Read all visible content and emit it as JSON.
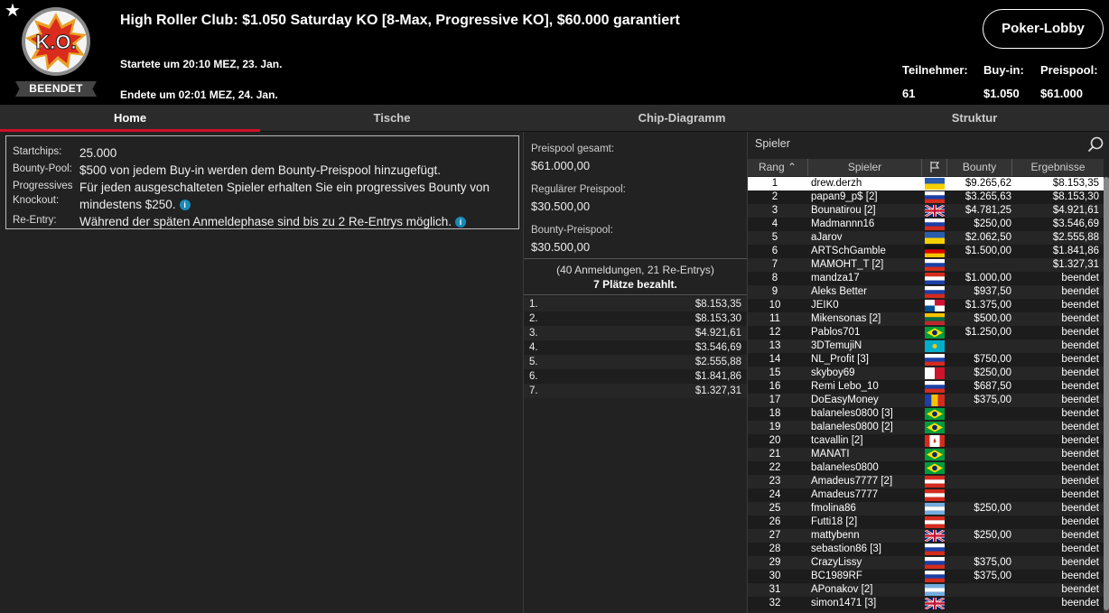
{
  "header": {
    "title": "High Roller Club: $1.050 Saturday KO [8-Max, Progressive KO], $60.000 garantiert",
    "logo_text": "K.O.",
    "status_badge": "BEENDET",
    "started": "Startete um 20:10 MEZ, 23. Jan.",
    "ended": "Endete um 02:01 MEZ, 24. Jan.",
    "lobby_button": "Poker-Lobby",
    "stats": {
      "participants_label": "Teilnehmer:",
      "participants_value": "61",
      "buyin_label": "Buy-in:",
      "buyin_value": "$1.050",
      "prizepool_label": "Preispool:",
      "prizepool_value": "$61.000"
    }
  },
  "tabs": [
    {
      "label": "Home",
      "active": true
    },
    {
      "label": "Tische",
      "active": false
    },
    {
      "label": "Chip-Diagramm",
      "active": false
    },
    {
      "label": "Struktur",
      "active": false
    }
  ],
  "info": {
    "startchips_label": "Startchips:",
    "startchips_value": "25.000",
    "bountypool_label": "Bounty-Pool:",
    "bountypool_value": "$500 von jedem Buy-in werden dem Bounty-Preispool hinzugefügt.",
    "pko_label": "Progressives Knockout:",
    "pko_value": "Für jeden ausgeschalteten Spieler erhalten Sie ein progressives Bounty von mindestens $250.",
    "reentry_label": "Re-Entry:",
    "reentry_value": "Während der späten Anmeldephase sind bis zu 2 Re-Entrys möglich."
  },
  "prize": {
    "total_label": "Preispool gesamt:",
    "total_value": "$61.000,00",
    "regular_label": "Regulärer Preispool:",
    "regular_value": "$30.500,00",
    "bounty_label": "Bounty-Preispool:",
    "bounty_value": "$30.500,00",
    "registrations": "(40 Anmeldungen, 21 Re-Entrys)",
    "paid_places": "7 Plätze bezahlt.",
    "payouts": [
      {
        "place": "1.",
        "amount": "$8.153,35"
      },
      {
        "place": "2.",
        "amount": "$8.153,30"
      },
      {
        "place": "3.",
        "amount": "$4.921,61"
      },
      {
        "place": "4.",
        "amount": "$3.546,69"
      },
      {
        "place": "5.",
        "amount": "$2.555,88"
      },
      {
        "place": "6.",
        "amount": "$1.841,86"
      },
      {
        "place": "7.",
        "amount": "$1.327,31"
      }
    ]
  },
  "players": {
    "search_placeholder": "Spieler",
    "columns": {
      "rank": "Rang",
      "player": "Spieler",
      "bounty": "Bounty",
      "result": "Ergebnisse"
    },
    "rows": [
      {
        "rank": "1",
        "name": "drew.derzh",
        "flag": "ukraine",
        "bounty": "$9.265,62",
        "result": "$8.153,35"
      },
      {
        "rank": "2",
        "name": "papan9_p$ [2]",
        "flag": "russia",
        "bounty": "$3.265,63",
        "result": "$8.153,30"
      },
      {
        "rank": "3",
        "name": "Bounatirou [2]",
        "flag": "uk",
        "bounty": "$4.781,25",
        "result": "$4.921,61"
      },
      {
        "rank": "4",
        "name": "Madmannn16",
        "flag": "russia",
        "bounty": "$250,00",
        "result": "$3.546,69"
      },
      {
        "rank": "5",
        "name": "aJarov",
        "flag": "ukraine",
        "bounty": "$2.062,50",
        "result": "$2.555,88"
      },
      {
        "rank": "6",
        "name": "ARTSchGamble",
        "flag": "germany",
        "bounty": "$1.500,00",
        "result": "$1.841,86"
      },
      {
        "rank": "7",
        "name": "MAMOHT_T [2]",
        "flag": "russia",
        "bounty": "",
        "result": "$1.327,31"
      },
      {
        "rank": "8",
        "name": "mandza17",
        "flag": "croatia",
        "bounty": "$1.000,00",
        "result": "beendet"
      },
      {
        "rank": "9",
        "name": "Aleks Better",
        "flag": "russia",
        "bounty": "$937,50",
        "result": "beendet"
      },
      {
        "rank": "10",
        "name": "JEIK0",
        "flag": "panama",
        "bounty": "$1.375,00",
        "result": "beendet"
      },
      {
        "rank": "11",
        "name": "Mikensonas [2]",
        "flag": "lithuania",
        "bounty": "$500,00",
        "result": "beendet"
      },
      {
        "rank": "12",
        "name": "Pablos701",
        "flag": "brazil",
        "bounty": "$1.250,00",
        "result": "beendet"
      },
      {
        "rank": "13",
        "name": "3DTemujiN",
        "flag": "kazakhstan",
        "bounty": "",
        "result": "beendet"
      },
      {
        "rank": "14",
        "name": "NL_Profit [3]",
        "flag": "russia",
        "bounty": "$750,00",
        "result": "beendet"
      },
      {
        "rank": "15",
        "name": "skyboy69",
        "flag": "malta",
        "bounty": "$250,00",
        "result": "beendet"
      },
      {
        "rank": "16",
        "name": "Remi Lebo_10",
        "flag": "russia",
        "bounty": "$687,50",
        "result": "beendet"
      },
      {
        "rank": "17",
        "name": "DoEasyMoney",
        "flag": "romania",
        "bounty": "$375,00",
        "result": "beendet"
      },
      {
        "rank": "18",
        "name": "balaneles0800 [3]",
        "flag": "brazil",
        "bounty": "",
        "result": "beendet"
      },
      {
        "rank": "19",
        "name": "balaneles0800 [2]",
        "flag": "brazil",
        "bounty": "",
        "result": "beendet"
      },
      {
        "rank": "20",
        "name": "tcavallin [2]",
        "flag": "canada",
        "bounty": "",
        "result": "beendet"
      },
      {
        "rank": "21",
        "name": "MANATI",
        "flag": "brazil",
        "bounty": "",
        "result": "beendet"
      },
      {
        "rank": "22",
        "name": "balaneles0800",
        "flag": "brazil",
        "bounty": "",
        "result": "beendet"
      },
      {
        "rank": "23",
        "name": "Amadeus7777 [2]",
        "flag": "austria",
        "bounty": "",
        "result": "beendet"
      },
      {
        "rank": "24",
        "name": "Amadeus7777",
        "flag": "austria",
        "bounty": "",
        "result": "beendet"
      },
      {
        "rank": "25",
        "name": "fmolina86",
        "flag": "argentina",
        "bounty": "$250,00",
        "result": "beendet"
      },
      {
        "rank": "26",
        "name": "Futti18 [2]",
        "flag": "austria",
        "bounty": "",
        "result": "beendet"
      },
      {
        "rank": "27",
        "name": "mattybenn",
        "flag": "uk",
        "bounty": "$250,00",
        "result": "beendet"
      },
      {
        "rank": "28",
        "name": "sebastion86 [3]",
        "flag": "russia",
        "bounty": "",
        "result": "beendet"
      },
      {
        "rank": "29",
        "name": "CrazyLissy",
        "flag": "russia",
        "bounty": "$375,00",
        "result": "beendet"
      },
      {
        "rank": "30",
        "name": "BC1989RF",
        "flag": "russia",
        "bounty": "$375,00",
        "result": "beendet"
      },
      {
        "rank": "31",
        "name": "APonakov [2]",
        "flag": "argentina",
        "bounty": "",
        "result": "beendet"
      },
      {
        "rank": "32",
        "name": "simon1471 [3]",
        "flag": "uk",
        "bounty": "",
        "result": "beendet"
      }
    ]
  },
  "colors": {
    "accent": "#d20f2a",
    "info_icon": "#1a8ab6"
  }
}
